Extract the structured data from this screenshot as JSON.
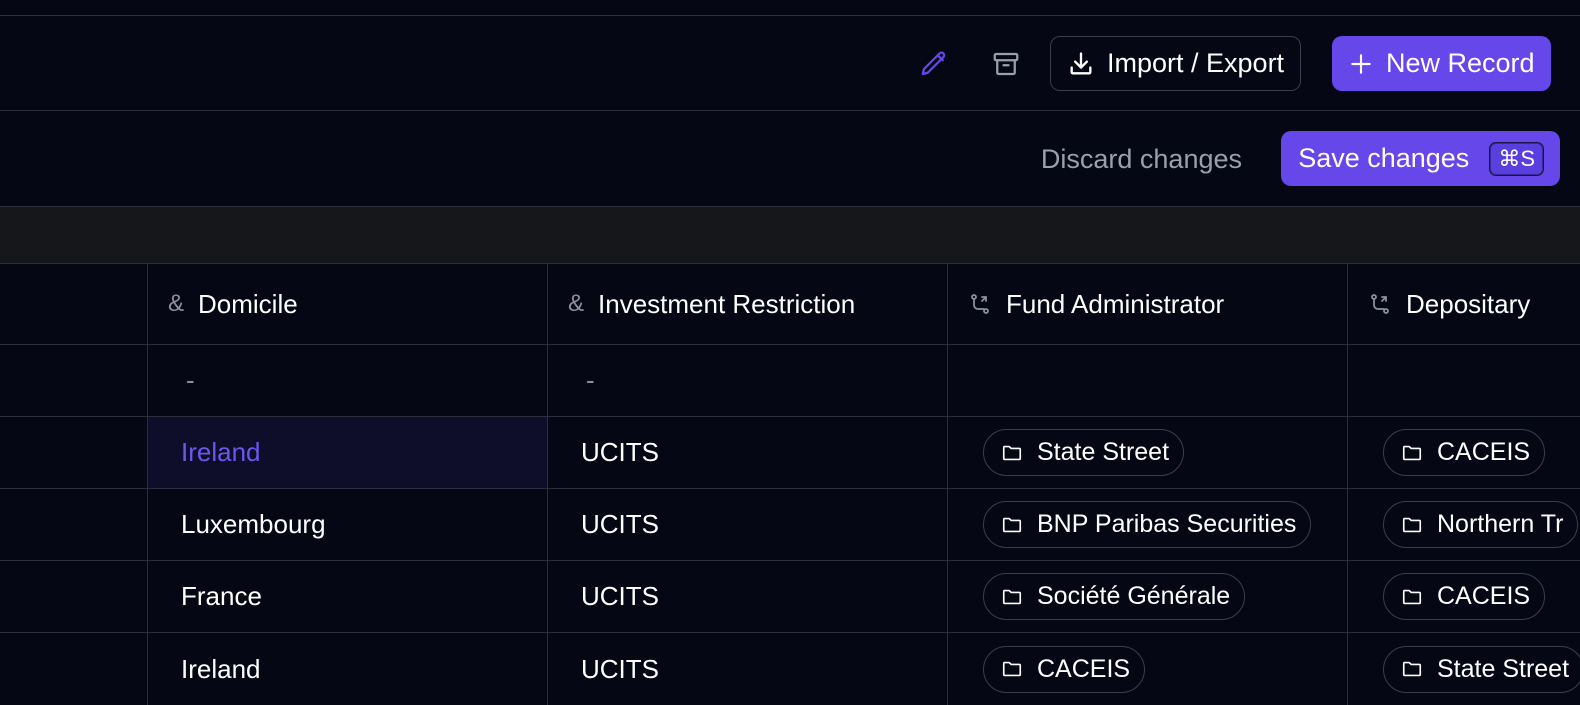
{
  "toolbar": {
    "edit_icon": "pencil-icon",
    "archive_icon": "archive-icon",
    "import_export_label": "Import / Export",
    "new_record_label": "New Record",
    "accent_color": "#6547ea"
  },
  "savebar": {
    "discard_label": "Discard changes",
    "save_label": "Save changes",
    "save_shortcut": "⌘S"
  },
  "table": {
    "columns": [
      {
        "label": "Domicile",
        "icon": "ampersand-icon"
      },
      {
        "label": "Investment Restriction",
        "icon": "ampersand-icon"
      },
      {
        "label": "Fund Administrator",
        "icon": "relation-icon"
      },
      {
        "label": "Depositary",
        "icon": "relation-icon"
      }
    ],
    "empty_value": "-",
    "rows": [
      {
        "domicile": "-",
        "restriction": "-",
        "administrator": "",
        "depositary": ""
      },
      {
        "domicile": "Ireland",
        "restriction": "UCITS",
        "administrator": "State Street",
        "depositary": "CACEIS"
      },
      {
        "domicile": "Luxembourg",
        "restriction": "UCITS",
        "administrator": "BNP Paribas Securities",
        "depositary": "Northern Tr"
      },
      {
        "domicile": "France",
        "restriction": "UCITS",
        "administrator": "Société Générale",
        "depositary": "CACEIS"
      },
      {
        "domicile": "Ireland",
        "restriction": "UCITS",
        "administrator": "CACEIS",
        "depositary": "State Street"
      }
    ]
  }
}
